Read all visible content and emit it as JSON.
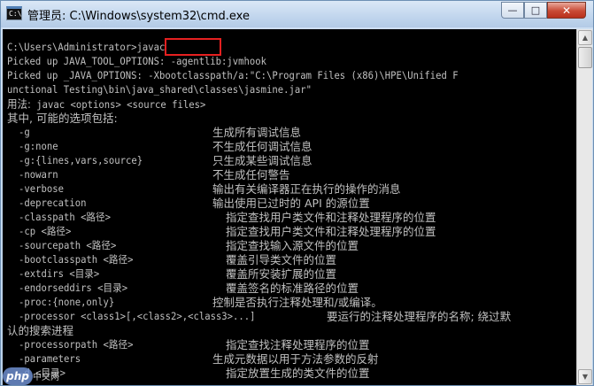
{
  "window": {
    "title": "管理员: C:\\Windows\\system32\\cmd.exe",
    "icon_text": "C:\\",
    "buttons": {
      "minimize": "—",
      "maximize": "□",
      "close": "✕"
    }
  },
  "console": {
    "prompt": "C:\\Users\\Administrator>",
    "command": "javac",
    "picked_up_1": "Picked up JAVA_TOOL_OPTIONS: -agentlib:jvmhook",
    "picked_up_2a": "Picked up _JAVA_OPTIONS: -Xbootclasspath/a:\"C:\\Program Files (x86)\\HPE\\Unified F",
    "picked_up_2b": "unctional Testing\\bin\\java_shared\\classes\\jasmine.jar\"",
    "usage_label": "用法:",
    "usage_value": "javac <options> <source files>",
    "options_header": "其中, 可能的选项包括:",
    "options": [
      {
        "flag": "-g",
        "desc": "生成所有调试信息"
      },
      {
        "flag": "-g:none",
        "desc": "不生成任何调试信息"
      },
      {
        "flag": "-g:{lines,vars,source}",
        "desc": "只生成某些调试信息"
      },
      {
        "flag": "-nowarn",
        "desc": "不生成任何警告"
      },
      {
        "flag": "-verbose",
        "desc": "输出有关编译器正在执行的操作的消息"
      },
      {
        "flag": "-deprecation",
        "desc": "输出使用已过时的 API 的源位置"
      },
      {
        "flag": "-classpath <路径>",
        "desc": "指定查找用户类文件和注释处理程序的位置"
      },
      {
        "flag": "-cp <路径>",
        "desc": "指定查找用户类文件和注释处理程序的位置"
      },
      {
        "flag": "-sourcepath <路径>",
        "desc": "指定查找输入源文件的位置"
      },
      {
        "flag": "-bootclasspath <路径>",
        "desc": "覆盖引导类文件的位置"
      },
      {
        "flag": "-extdirs <目录>",
        "desc": "覆盖所安装扩展的位置"
      },
      {
        "flag": "-endorseddirs <目录>",
        "desc": "覆盖签名的标准路径的位置"
      },
      {
        "flag": "-proc:{none,only}",
        "desc": "控制是否执行注释处理和/或编译。"
      },
      {
        "flag": "-processor <class1>[,<class2>,<class3>...]",
        "desc": "要运行的注释处理程序的名称; 绕过默"
      },
      {
        "flag": "",
        "desc": "认的搜索进程"
      },
      {
        "flag": "-processorpath <路径>",
        "desc": "指定查找注释处理程序的位置"
      },
      {
        "flag": "-parameters",
        "desc": "生成元数据以用于方法参数的反射"
      },
      {
        "flag": "-d <目录>",
        "desc": "指定放置生成的类文件的位置"
      }
    ]
  },
  "watermark": {
    "brand": "php",
    "site": "中文网"
  }
}
